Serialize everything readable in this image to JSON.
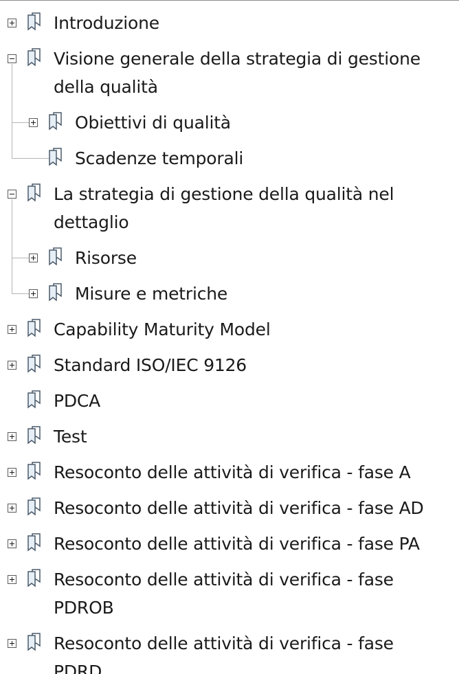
{
  "tree": [
    {
      "label": [
        "Introduzione"
      ],
      "level": 0,
      "toggle": "collapsed"
    },
    {
      "label": [
        "Visione generale della strategia di gestione",
        "della qualità"
      ],
      "level": 0,
      "toggle": "expanded"
    },
    {
      "label": [
        "Obiettivi di qualità"
      ],
      "level": 1,
      "toggle": "collapsed"
    },
    {
      "label": [
        "Scadenze temporali"
      ],
      "level": 1,
      "toggle": "none"
    },
    {
      "label": [
        "La strategia di gestione della qualità nel",
        "dettaglio"
      ],
      "level": 0,
      "toggle": "expanded"
    },
    {
      "label": [
        "Risorse"
      ],
      "level": 1,
      "toggle": "collapsed"
    },
    {
      "label": [
        "Misure e metriche"
      ],
      "level": 1,
      "toggle": "collapsed"
    },
    {
      "label": [
        "Capability Maturity Model"
      ],
      "level": 0,
      "toggle": "collapsed"
    },
    {
      "label": [
        "Standard ISO/IEC 9126"
      ],
      "level": 0,
      "toggle": "collapsed"
    },
    {
      "label": [
        "PDCA"
      ],
      "level": 0,
      "toggle": "none"
    },
    {
      "label": [
        "Test"
      ],
      "level": 0,
      "toggle": "collapsed"
    },
    {
      "label": [
        "Resoconto delle attività di verifica - fase A"
      ],
      "level": 0,
      "toggle": "collapsed"
    },
    {
      "label": [
        "Resoconto delle attività di verifica - fase AD"
      ],
      "level": 0,
      "toggle": "collapsed"
    },
    {
      "label": [
        "Resoconto delle attività di verifica - fase PA"
      ],
      "level": 0,
      "toggle": "collapsed"
    },
    {
      "label": [
        "Resoconto delle attività di verifica - fase",
        "PDROB"
      ],
      "level": 0,
      "toggle": "collapsed"
    },
    {
      "label": [
        "Resoconto delle attività di verifica - fase",
        "PDRD"
      ],
      "level": 0,
      "toggle": "collapsed"
    }
  ],
  "icons": {
    "toggle_collapsed": "plus-box-icon",
    "toggle_expanded": "minus-box-icon",
    "bookmark": "bookmark-icon"
  },
  "colors": {
    "text": "#1a1a1a",
    "tree_line": "#b4b4b4",
    "bookmark_fill": "#e6eef6",
    "bookmark_stroke": "#4a5a6a"
  }
}
